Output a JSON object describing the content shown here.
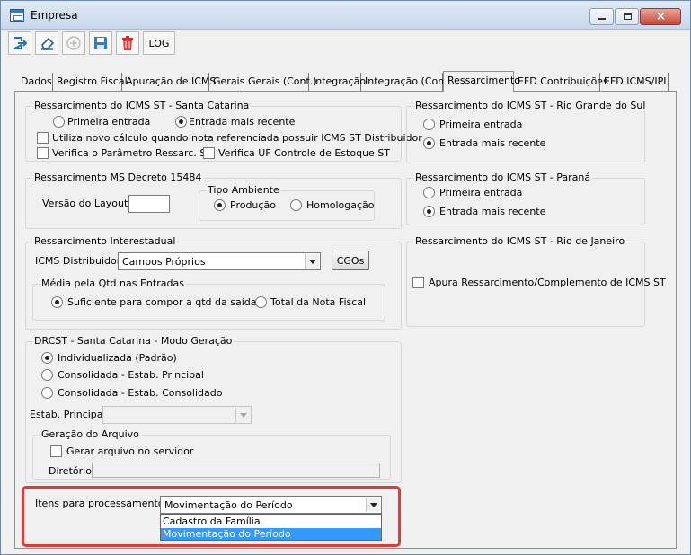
{
  "window": {
    "title": "Empresa"
  },
  "toolbar": {
    "log_label": "LOG"
  },
  "tabs": [
    {
      "label": "Dados"
    },
    {
      "label": "Registro Fiscal"
    },
    {
      "label": "Apuração de ICMS"
    },
    {
      "label": "Gerais"
    },
    {
      "label": "Gerais (Cont.)"
    },
    {
      "label": "Integração"
    },
    {
      "label": "Integração (Com.)"
    },
    {
      "label": "Ressarcimento"
    },
    {
      "label": "EFD Contribuições"
    },
    {
      "label": "EFD ICMS/IPI"
    }
  ],
  "sc": {
    "title": "Ressarcimento do ICMS ST - Santa Catarina",
    "radio_first": "Primeira entrada",
    "radio_recent": "Entrada mais recente",
    "chk_new_calc": "Utiliza novo cálculo quando nota referenciada possuir ICMS ST Distribuidor",
    "chk_param": "Verifica o Parâmetro Ressarc. ST",
    "chk_uf": "Verifica UF Controle de Estoque ST"
  },
  "rs": {
    "title": "Ressarcimento do ICMS ST - Rio Grande do Sul",
    "radio_first": "Primeira entrada",
    "radio_recent": "Entrada mais recente"
  },
  "ms": {
    "title": "Ressarcimento MS Decreto 15484",
    "layout_label": "Versão do Layout",
    "ambiente_title": "Tipo Ambiente",
    "prod": "Produção",
    "homolog": "Homologação"
  },
  "pr": {
    "title": "Ressarcimento do ICMS ST - Paraná",
    "radio_first": "Primeira entrada",
    "radio_recent": "Entrada mais recente"
  },
  "inter": {
    "title": "Ressarcimento Interestadual",
    "dist_label": "ICMS Distribuidor:",
    "dist_value": "Campos Próprios",
    "cgos": "CGOs",
    "media_title": "Média pela Qtd nas Entradas",
    "sufficient": "Suficiente para compor a qtd da saída",
    "total": "Total da Nota Fiscal"
  },
  "rj": {
    "title": "Ressarcimento do ICMS ST - Rio de Janeiro",
    "chk": "Apura Ressarcimento/Complemento de ICMS ST"
  },
  "drcst": {
    "title": "DRCST - Santa Catarina - Modo Geração",
    "opt1": "Individualizada (Padrão)",
    "opt2": "Consolidada - Estab. Principal",
    "opt3": "Consolidada - Estab. Consolidado",
    "estab_label": "Estab. Principal",
    "geracao_title": "Geração do Arquivo",
    "gerar_chk": "Gerar arquivo no servidor",
    "diretorio": "Diretório"
  },
  "itens": {
    "label": "Itens para processamento",
    "value": "Movimentação do Período",
    "options": [
      "Cadastro da Família",
      "Movimentação do Período"
    ]
  },
  "colors": {
    "highlight": "#e23b37",
    "selection": "#3399ff"
  }
}
